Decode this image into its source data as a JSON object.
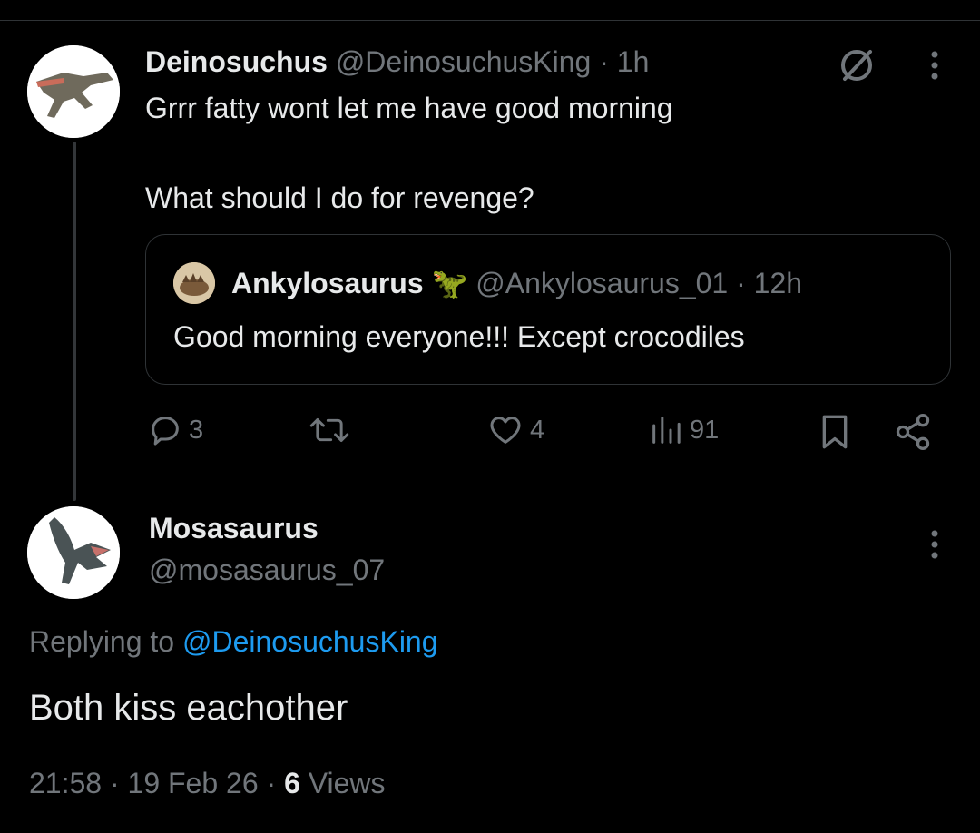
{
  "tweet": {
    "author_name": "Deinosuchus",
    "author_handle": "@DeinosuchusKing",
    "time": "1h",
    "text_line1": "Grrr fatty wont let me have good morning",
    "text_line2": "What should I do for revenge?",
    "quote": {
      "author_name": "Ankylosaurus",
      "author_emoji": "🦖",
      "author_handle": "@Ankylosaurus_01",
      "time": "12h",
      "text": "Good morning everyone!!! Except crocodiles"
    },
    "actions": {
      "replies": "3",
      "reposts": "",
      "likes": "4",
      "views": "91"
    }
  },
  "reply": {
    "author_name": "Mosasaurus",
    "author_handle": "@mosasaurus_07",
    "replying_prefix": "Replying to",
    "replying_to": "@DeinosuchusKing",
    "text": "Both kiss eachother",
    "time": "21:58",
    "date": "19 Feb 26",
    "views_count": "6",
    "views_label": "Views"
  },
  "separator": "·",
  "colors": {
    "background": "#000000",
    "text": "#e7e9ea",
    "muted": "#71767b",
    "link": "#1d9bf0",
    "border": "#2f3336"
  }
}
